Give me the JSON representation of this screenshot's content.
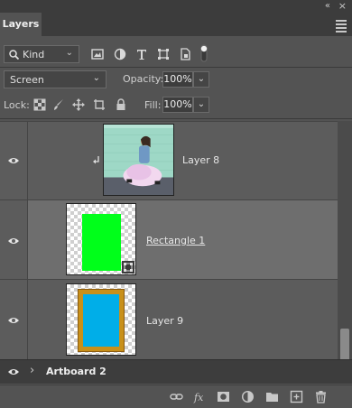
{
  "panel": {
    "tab_label": "Layers",
    "collapse_glyph": "«",
    "close_glyph": "×"
  },
  "filter": {
    "kind_label": "Kind",
    "kind_chevron": "⌄",
    "icons": [
      "image-filter-icon",
      "adjustment-filter-icon",
      "type-filter-icon",
      "shape-filter-icon",
      "smart-object-filter-icon"
    ]
  },
  "blend": {
    "mode": "Screen",
    "opacity_label": "Opacity:",
    "opacity_value": "100%"
  },
  "lock": {
    "label": "Lock:",
    "fill_label": "Fill:",
    "fill_value": "100%"
  },
  "layers": [
    {
      "name": "Layer 8",
      "visible": true,
      "clipped": true,
      "thumb": "photo"
    },
    {
      "name": "Rectangle 1",
      "visible": true,
      "selected": true,
      "thumb": "green-rect"
    },
    {
      "name": "Layer 9",
      "visible": true,
      "thumb": "frame"
    }
  ],
  "artboard": {
    "name": "Artboard 2",
    "chevron": "›"
  },
  "colors": {
    "panel_bg": "#535353",
    "selected_bg": "#6e6e6e",
    "rect_green": "#00ff1a",
    "frame_blue": "#00aee8",
    "frame_gold": "#c8901a"
  }
}
